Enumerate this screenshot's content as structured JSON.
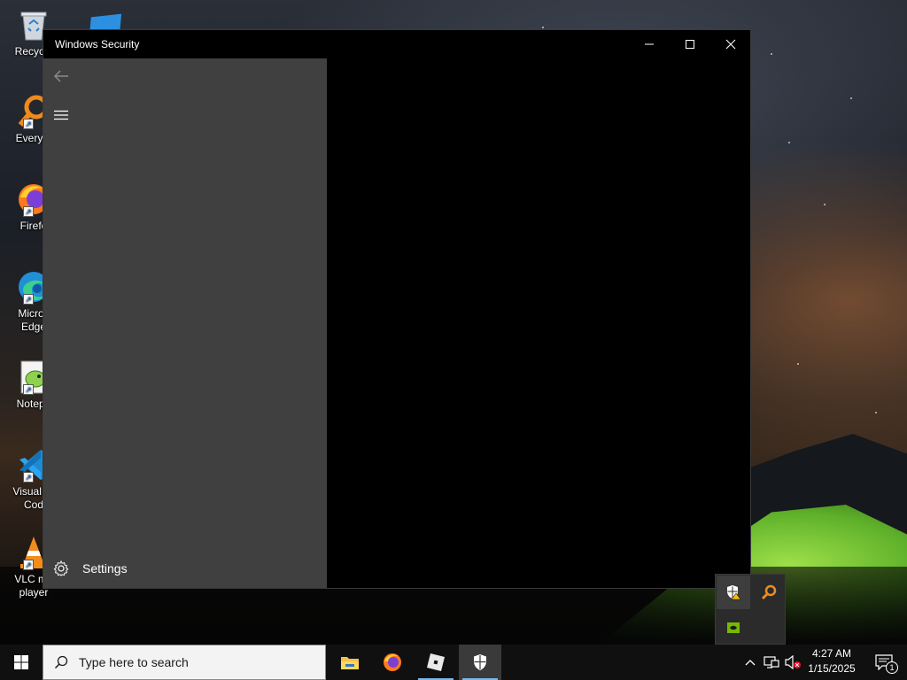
{
  "desktop": {
    "icons": [
      {
        "label": "Recycle"
      },
      {
        "label": "Everyth"
      },
      {
        "label": "Firefo"
      },
      {
        "label": "Micros\nEdge"
      },
      {
        "label": "Notepa"
      },
      {
        "label": "Visual St\nCod"
      },
      {
        "label": "VLC me\nplayer"
      }
    ]
  },
  "window": {
    "title": "Windows Security",
    "controls": {
      "minimize": "minimize-icon",
      "maximize": "maximize-icon",
      "close": "close-icon"
    },
    "sidebar": {
      "back_icon": "arrow-left-icon",
      "menu_icon": "hamburger-icon",
      "settings_label": "Settings",
      "settings_icon": "gear-icon"
    }
  },
  "tray_overflow": {
    "icons": [
      "security-shield-warning-icon",
      "search-magnifier-icon",
      "nvidia-icon"
    ]
  },
  "taskbar": {
    "search_placeholder": "Type here to search",
    "apps": [
      {
        "name": "File Explorer",
        "icon": "folder-icon"
      },
      {
        "name": "Firefox",
        "icon": "firefox-icon"
      },
      {
        "name": "Roblox",
        "icon": "roblox-icon"
      },
      {
        "name": "Windows Security",
        "icon": "shield-icon",
        "active": true
      }
    ],
    "time": "4:27 AM",
    "date": "1/15/2025",
    "notification_count": "1"
  },
  "colors": {
    "sidebar_bg": "#404040",
    "window_bg": "#000000",
    "taskbar_bg": "#101010",
    "accent": "#76b9ed"
  }
}
